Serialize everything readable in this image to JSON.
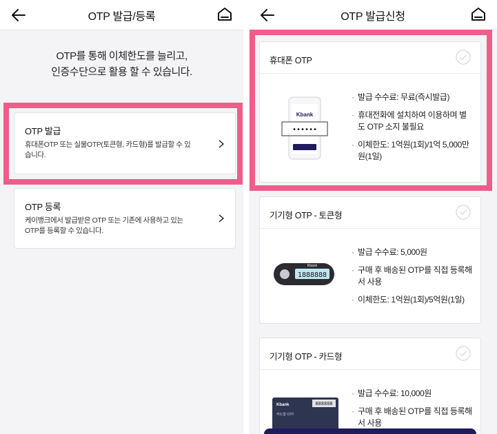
{
  "left": {
    "header": {
      "title": "OTP 발급/등록",
      "back_icon": "arrow-left-icon",
      "home_icon": "home-icon"
    },
    "intro": {
      "line1": "OTP를 통해 이체한도를 늘리고,",
      "line2": "인증수단으로 활용 할 수 있습니다."
    },
    "cards": [
      {
        "title": "OTP 발급",
        "desc_line1": "휴대폰OTP 또는 실물OTP(토큰형, 카드형)를 발급할 수 있",
        "desc_line2": "습니다."
      },
      {
        "title": "OTP 등록",
        "desc_line1": "케이뱅크에서 발급받은 OTP 또는 기존에 사용하고 있는",
        "desc_line2": "OTP를 등록할 수 있습니다."
      }
    ]
  },
  "right": {
    "header": {
      "title": "OTP 발급신청",
      "back_icon": "arrow-left-icon",
      "home_icon": "home-icon"
    },
    "cards": [
      {
        "title": "휴대폰 OTP",
        "image_brand": "Kbank",
        "image_code": "••••••",
        "features": [
          "발급 수수료: 무료(즉시발급)",
          "휴대전화에 설치하여 이용하며 별도 OTP 소지 불필요",
          "이체한도: 1억원(1회)/1억 5,000만원(1일)"
        ]
      },
      {
        "title": "기기형 OTP - 토큰형",
        "image_brand": "Kbank",
        "image_code": "1888888",
        "features": [
          "발급 수수료: 5,000원",
          "구매 후 배송된 OTP를 직접 등록해서 사용",
          "이체한도: 1억원(1회)/5억원(1일)"
        ]
      },
      {
        "title": "기기형 OTP - 카드형",
        "image_brand": "Kbank",
        "image_code": "888888",
        "image_label": "카드형 OTP",
        "features": [
          "발급 수수료: 10,000원",
          "구매 후 배송된 OTP를 직접 등록해서 사용"
        ]
      }
    ]
  },
  "colors": {
    "highlight": "#ef5d8b",
    "brand_navy": "#1f1b5c",
    "background": "#f4f4f6"
  }
}
